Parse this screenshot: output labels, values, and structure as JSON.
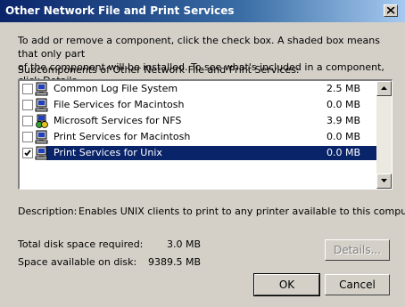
{
  "window": {
    "title": "Other Network File and Print Services"
  },
  "instructions": "To add or remove a component, click the check box. A shaded box means that only part\nof the component will be installed. To see what's included in a component, click Details.",
  "subcomponents_label": "Subcomponents of Other Network File and Print Services:",
  "components": [
    {
      "name": "Common Log File System",
      "size": "2.5 MB",
      "checked": false,
      "icon": "computer-icon"
    },
    {
      "name": "File Services for Macintosh",
      "size": "0.0 MB",
      "checked": false,
      "icon": "computer-icon"
    },
    {
      "name": "Microsoft Services for NFS",
      "size": "3.9 MB",
      "checked": false,
      "icon": "network-services-icon"
    },
    {
      "name": "Print Services for Macintosh",
      "size": "0.0 MB",
      "checked": false,
      "icon": "computer-icon"
    },
    {
      "name": "Print Services for Unix",
      "size": "0.0 MB",
      "checked": true,
      "selected": true,
      "icon": "computer-icon"
    }
  ],
  "description": {
    "label": "Description:",
    "text": "Enables UNIX clients to print to any printer available to this computer."
  },
  "disk": {
    "required_label": "Total disk space required:",
    "required_value": "3.0 MB",
    "available_label": "Space available on disk:",
    "available_value": "9389.5 MB"
  },
  "buttons": {
    "details": "Details...",
    "ok": "OK",
    "cancel": "Cancel"
  },
  "colors": {
    "title_bar": "#0a246a",
    "selection": "#0a246a",
    "face": "#d4d0c8"
  }
}
